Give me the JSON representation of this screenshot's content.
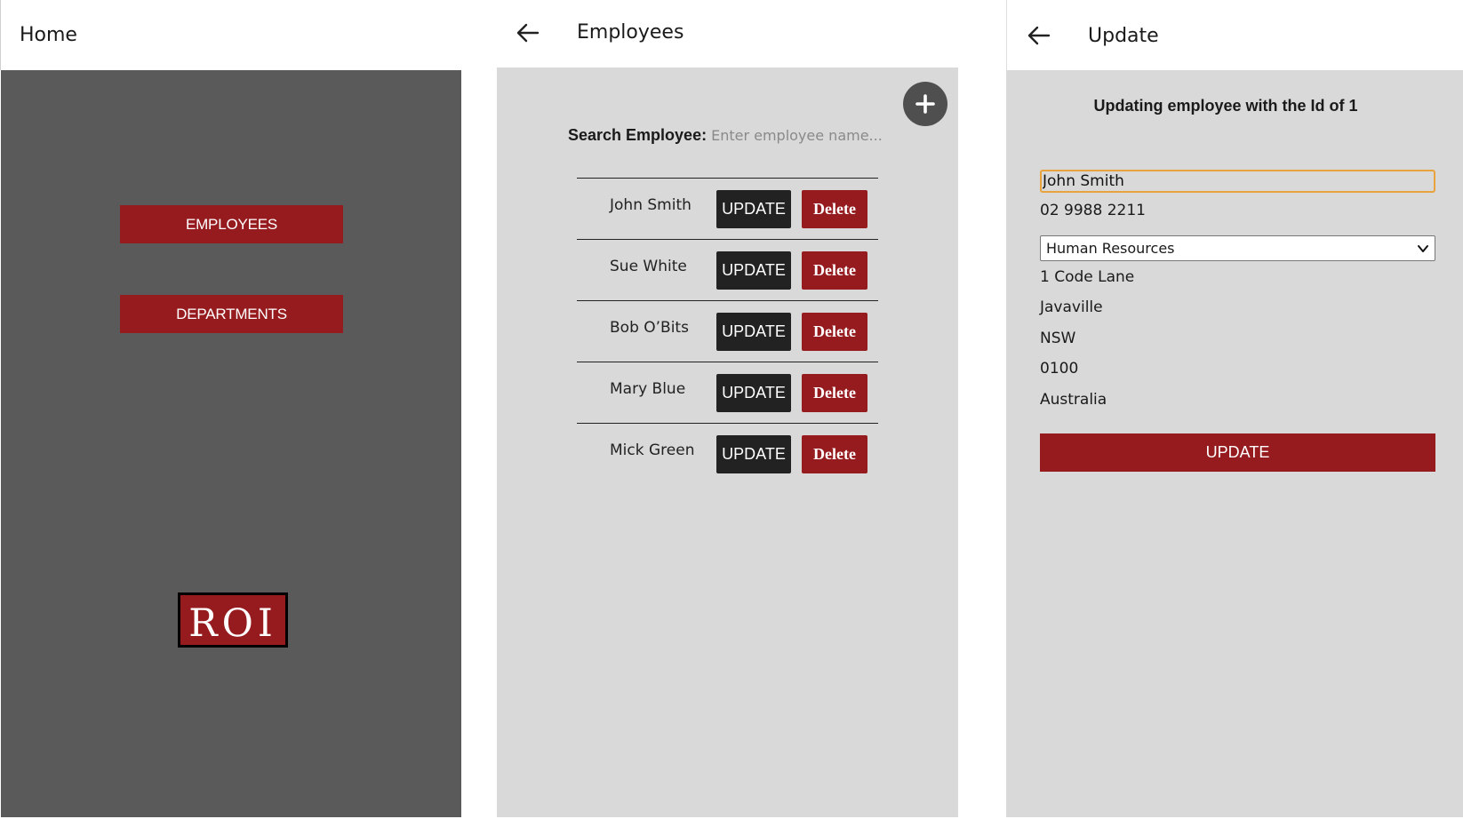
{
  "home": {
    "title": "Home",
    "employees_button": "EMPLOYEES",
    "departments_button": "DEPARTMENTS",
    "logo_text": "ROI"
  },
  "employees": {
    "title": "Employees",
    "search_label": "Search Employee:",
    "search_placeholder": "Enter employee name...",
    "update_label": "UPDATE",
    "delete_label": "Delete",
    "list": [
      {
        "name": "John Smith"
      },
      {
        "name": "Sue White"
      },
      {
        "name": "Bob O’Bits"
      },
      {
        "name": "Mary Blue"
      },
      {
        "name": "Mick Green"
      }
    ]
  },
  "update": {
    "title": "Update",
    "heading": "Updating employee with the Id of 1",
    "name_value": "John Smith",
    "phone": "02 9988 2211",
    "department": "Human Resources",
    "street": "1 Code Lane",
    "city": "Javaville",
    "state": "NSW",
    "postcode": "0100",
    "country": "Australia",
    "button": "UPDATE"
  },
  "colors": {
    "brand_red": "#961b1e",
    "dark_panel": "#5a5a5a",
    "light_panel": "#d9d9d9",
    "dark_button": "#222222"
  }
}
